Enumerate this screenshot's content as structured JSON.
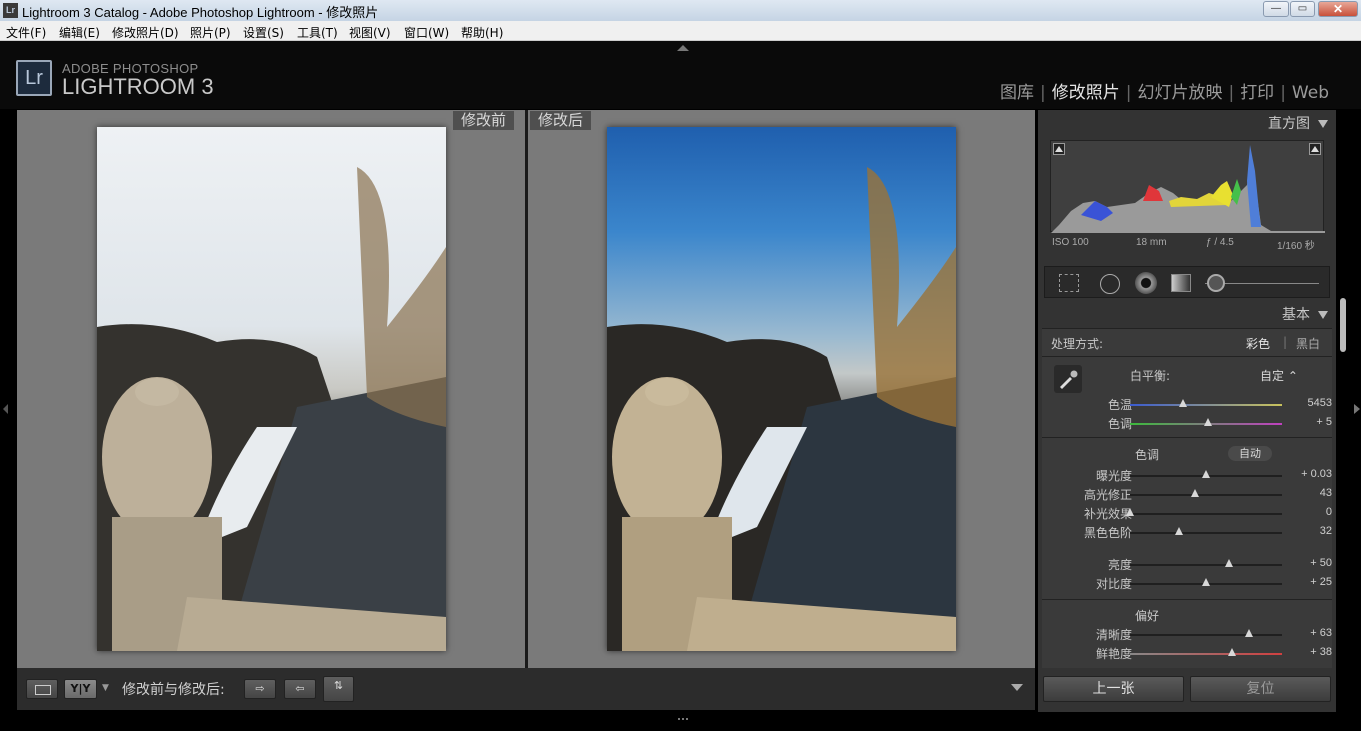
{
  "window": {
    "title": "Lightroom 3 Catalog - Adobe Photoshop Lightroom - 修改照片",
    "icon_text": "Lr",
    "min": "—",
    "max": "▭",
    "close": "✕"
  },
  "menu": [
    "文件(F)",
    "编辑(E)",
    "修改照片(D)",
    "照片(P)",
    "设置(S)",
    "工具(T)",
    "视图(V)",
    "窗口(W)",
    "帮助(H)"
  ],
  "brand": {
    "logo": "Lr",
    "top": "ADOBE PHOTOSHOP",
    "main": "LIGHTROOM 3"
  },
  "modules": [
    {
      "label": "图库",
      "active": false
    },
    {
      "label": "修改照片",
      "active": true
    },
    {
      "label": "幻灯片放映",
      "active": false
    },
    {
      "label": "打印",
      "active": false
    },
    {
      "label": "Web",
      "active": false
    }
  ],
  "viewer": {
    "before_label": "修改前",
    "after_label": "修改后"
  },
  "toolbar": {
    "yy_label": "Y|Y",
    "compare_label": "修改前与修改后:",
    "copy_right_icon": "⇨",
    "copy_left_icon": "⇦",
    "swap_icon": "⇅"
  },
  "panels": {
    "histogram_title": "直方图",
    "basic_title": "基本"
  },
  "exif": {
    "iso": "ISO 100",
    "focal": "18 mm",
    "aperture": "ƒ / 4.5",
    "shutter": "1/160 秒"
  },
  "basic": {
    "treatment_label": "处理方式:",
    "treatment_color": "彩色",
    "treatment_bw": "黑白",
    "wb_label": "白平衡:",
    "wb_value": "自定 ⌃",
    "tone_title": "色调",
    "tone_auto": "自动",
    "presence_title": "偏好",
    "sliders": {
      "temp": {
        "label": "色温",
        "value": "5453",
        "pos": 0.35
      },
      "tint": {
        "label": "色调",
        "value": "+ 5",
        "pos": 0.51
      },
      "exposure": {
        "label": "曝光度",
        "value": "+ 0.03",
        "pos": 0.5
      },
      "recovery": {
        "label": "高光修正",
        "value": "43",
        "pos": 0.43
      },
      "fill": {
        "label": "补光效果",
        "value": "0",
        "pos": 0.0
      },
      "blacks": {
        "label": "黑色色阶",
        "value": "32",
        "pos": 0.32
      },
      "brightness": {
        "label": "亮度",
        "value": "+ 50",
        "pos": 0.65
      },
      "contrast": {
        "label": "对比度",
        "value": "+ 25",
        "pos": 0.5
      },
      "clarity": {
        "label": "清晰度",
        "value": "+ 63",
        "pos": 0.78
      },
      "vibrance": {
        "label": "鲜艳度",
        "value": "+ 38",
        "pos": 0.67
      }
    }
  },
  "buttons": {
    "prev": "上一张",
    "reset": "复位"
  }
}
